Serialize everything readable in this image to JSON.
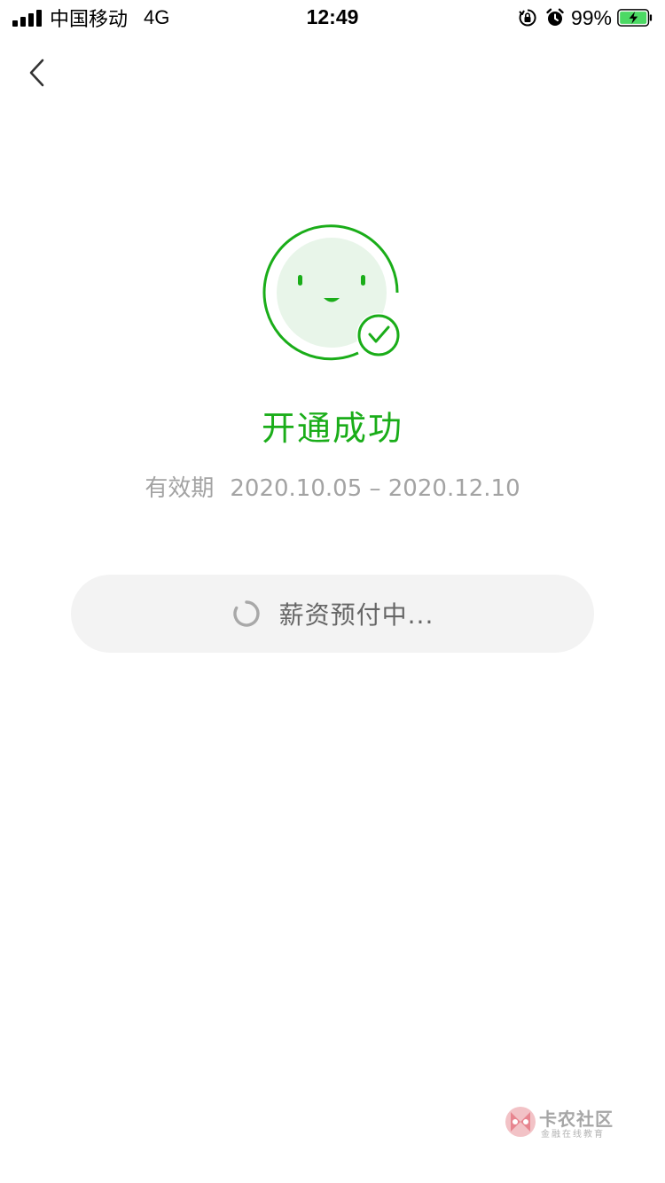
{
  "status_bar": {
    "carrier": "中国移动",
    "network": "4G",
    "time": "12:49",
    "battery_percent": "99%",
    "icons": [
      "signal-icon",
      "orientation-lock-icon",
      "alarm-icon",
      "battery-charging-icon"
    ],
    "battery_color": "#4cd964"
  },
  "nav": {
    "back_icon": "chevron-left-icon"
  },
  "result": {
    "icon": "smiley-check-icon",
    "title": "开通成功",
    "validity_label": "有效期",
    "validity_range": "2020.10.05 – 2020.12.10",
    "accent_color": "#1aad19"
  },
  "progress": {
    "icon": "loading-spinner-icon",
    "text": "薪资预付中..."
  },
  "watermark": {
    "title": "卡农社区",
    "subtitle": "金融在线教育"
  }
}
